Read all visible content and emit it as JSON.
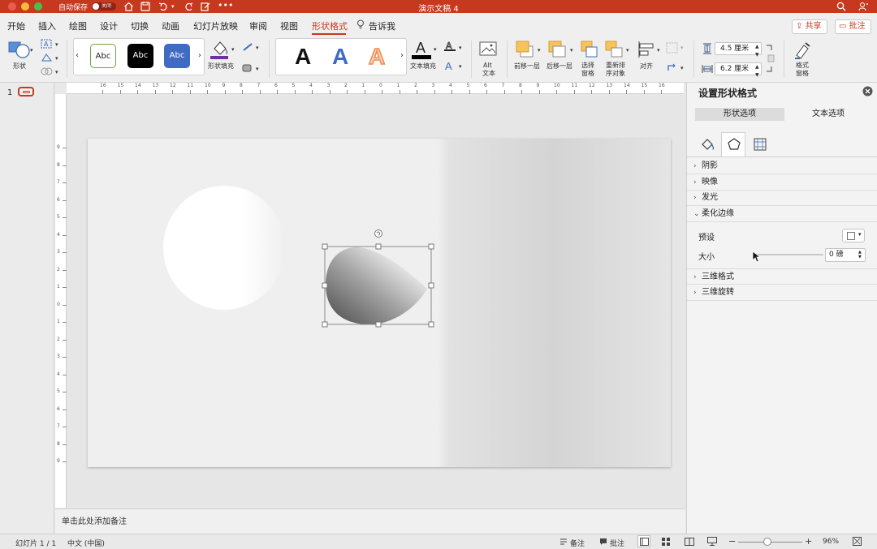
{
  "window": {
    "title": "演示文稿 4",
    "autosave_label": "自动保存",
    "autosave_state": "关闭"
  },
  "tabs": [
    {
      "label": "开始"
    },
    {
      "label": "插入"
    },
    {
      "label": "绘图"
    },
    {
      "label": "设计"
    },
    {
      "label": "切换"
    },
    {
      "label": "动画"
    },
    {
      "label": "幻灯片放映"
    },
    {
      "label": "审阅"
    },
    {
      "label": "视图"
    },
    {
      "label": "形状格式"
    },
    {
      "label": "告诉我"
    }
  ],
  "header_buttons": {
    "share": "共享",
    "comment": "批注"
  },
  "ribbon": {
    "shape_label": "形状",
    "style_samples": [
      "Abc",
      "Abc",
      "Abc"
    ],
    "shape_fill_label": "形状填充",
    "wordart_letters": [
      "A",
      "A",
      "A"
    ],
    "text_fill_label": "文本填充",
    "alt_text_label_1": "Alt",
    "alt_text_label_2": "文本",
    "bring_forward_label": "前移一层",
    "send_backward_label": "后移一层",
    "selection_pane_label_1": "选择",
    "selection_pane_label_2": "窗格",
    "reorder_label_1": "重新排",
    "reorder_label_2": "序对象",
    "align_label": "对齐",
    "height_value": "4.5 厘米",
    "width_value": "6.2 厘米",
    "format_pane_label_1": "格式",
    "format_pane_label_2": "窗格"
  },
  "ruler": {
    "h_ticks": [
      "16",
      "15",
      "14",
      "13",
      "12",
      "11",
      "10",
      "9",
      "8",
      "7",
      "6",
      "5",
      "4",
      "3",
      "2",
      "1",
      "0",
      "1",
      "2",
      "3",
      "4",
      "5",
      "6",
      "7",
      "8",
      "9",
      "10",
      "11",
      "12",
      "13",
      "14",
      "15",
      "16"
    ],
    "v_ticks": [
      "9",
      "8",
      "7",
      "6",
      "5",
      "4",
      "3",
      "2",
      "1",
      "0",
      "1",
      "2",
      "3",
      "4",
      "5",
      "6",
      "7",
      "8",
      "9"
    ]
  },
  "thumbnail": {
    "number": "1"
  },
  "notes_placeholder": "单击此处添加备注",
  "format_pane": {
    "title": "设置形状格式",
    "tab_shape": "形状选项",
    "tab_text": "文本选项",
    "sections": {
      "shadow": "阴影",
      "reflection": "映像",
      "glow": "发光",
      "soft_edges": "柔化边缘",
      "format_3d": "三维格式",
      "rotation_3d": "三维旋转"
    },
    "preset_label": "预设",
    "size_label": "大小",
    "size_value": "0 磅"
  },
  "statusbar": {
    "slide_info": "幻灯片 1 / 1",
    "language": "中文 (中国)",
    "notes_label": "备注",
    "comments_label": "批注",
    "zoom": "96%"
  },
  "colors": {
    "accent": "#c7391f",
    "blue_style": "#3f6bc4",
    "wordart_blue": "#3d6cc4",
    "wordart_orange": "#ee8a4f"
  }
}
